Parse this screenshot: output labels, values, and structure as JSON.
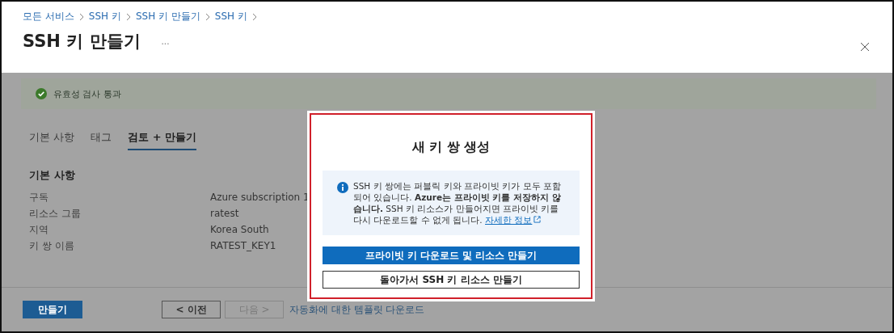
{
  "breadcrumb": [
    "모든 서비스",
    "SSH 키",
    "SSH 키 만들기",
    "SSH 키"
  ],
  "title": "SSH 키 만들기",
  "more": "...",
  "validation": {
    "text": "유효성 검사 통과",
    "passed": true
  },
  "tabs": [
    {
      "label": "기본 사항",
      "selected": false
    },
    {
      "label": "태그",
      "selected": false
    },
    {
      "label": "검토 + 만들기",
      "selected": true
    }
  ],
  "section": {
    "heading": "기본 사항",
    "rows": [
      {
        "label": "구독",
        "value": "Azure subscription 1"
      },
      {
        "label": "리소스 그룹",
        "value": "ratest"
      },
      {
        "label": "지역",
        "value": "Korea South"
      },
      {
        "label": "키 쌍 이름",
        "value": "RATEST_KEY1"
      }
    ]
  },
  "footer": {
    "create": "만들기",
    "previous": {
      "label": "< 이전",
      "disabled": false
    },
    "next": {
      "label": "다음 >",
      "disabled": true
    },
    "template_link": "자동화에 대한 템플릿 다운로드"
  },
  "dialog": {
    "title": "새 키 쌍 생성",
    "info": {
      "text": "SSH 키 쌍에는 퍼블릭 키와 프라이빗 키가 모두 포함되어 있습니다. **Azure는 프라이빗 키를 저장하지 않습니다.** SSH 키 리소스가 만들어지면 프라이빗 키를 다시 다운로드할 수 없게 됩니다.",
      "link": "자세한 정보"
    },
    "buttons": [
      {
        "label": "프라이빗 키 다운로드 및 리소스 만들기",
        "kind": "primary"
      },
      {
        "label": "돌아가서 SSH 키 리소스 만들기",
        "kind": "secondary"
      }
    ]
  }
}
